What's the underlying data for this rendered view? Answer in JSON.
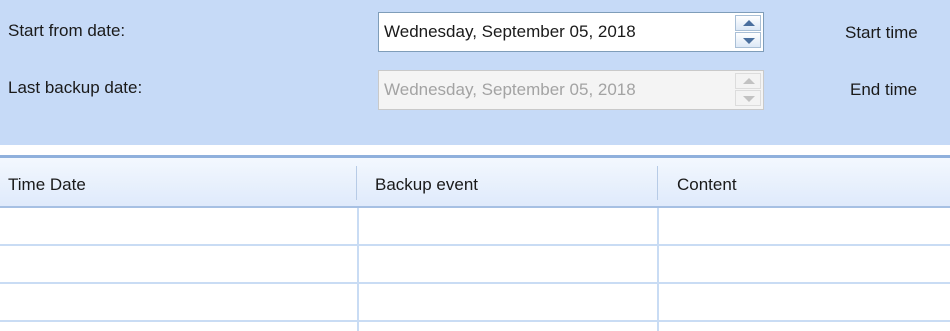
{
  "filters": {
    "start_from_label": "Start from date:",
    "start_from_value": "Wednesday, September 05, 2018",
    "last_backup_label": "Last backup date:",
    "last_backup_value": "Wednesday, September 05, 2018",
    "start_time_label": "Start time",
    "end_time_label": "End time"
  },
  "table": {
    "columns": [
      "Time Date",
      "Backup event",
      "Content"
    ],
    "rows": [
      [
        "",
        "",
        ""
      ],
      [
        "",
        "",
        ""
      ],
      [
        "",
        "",
        ""
      ]
    ]
  }
}
